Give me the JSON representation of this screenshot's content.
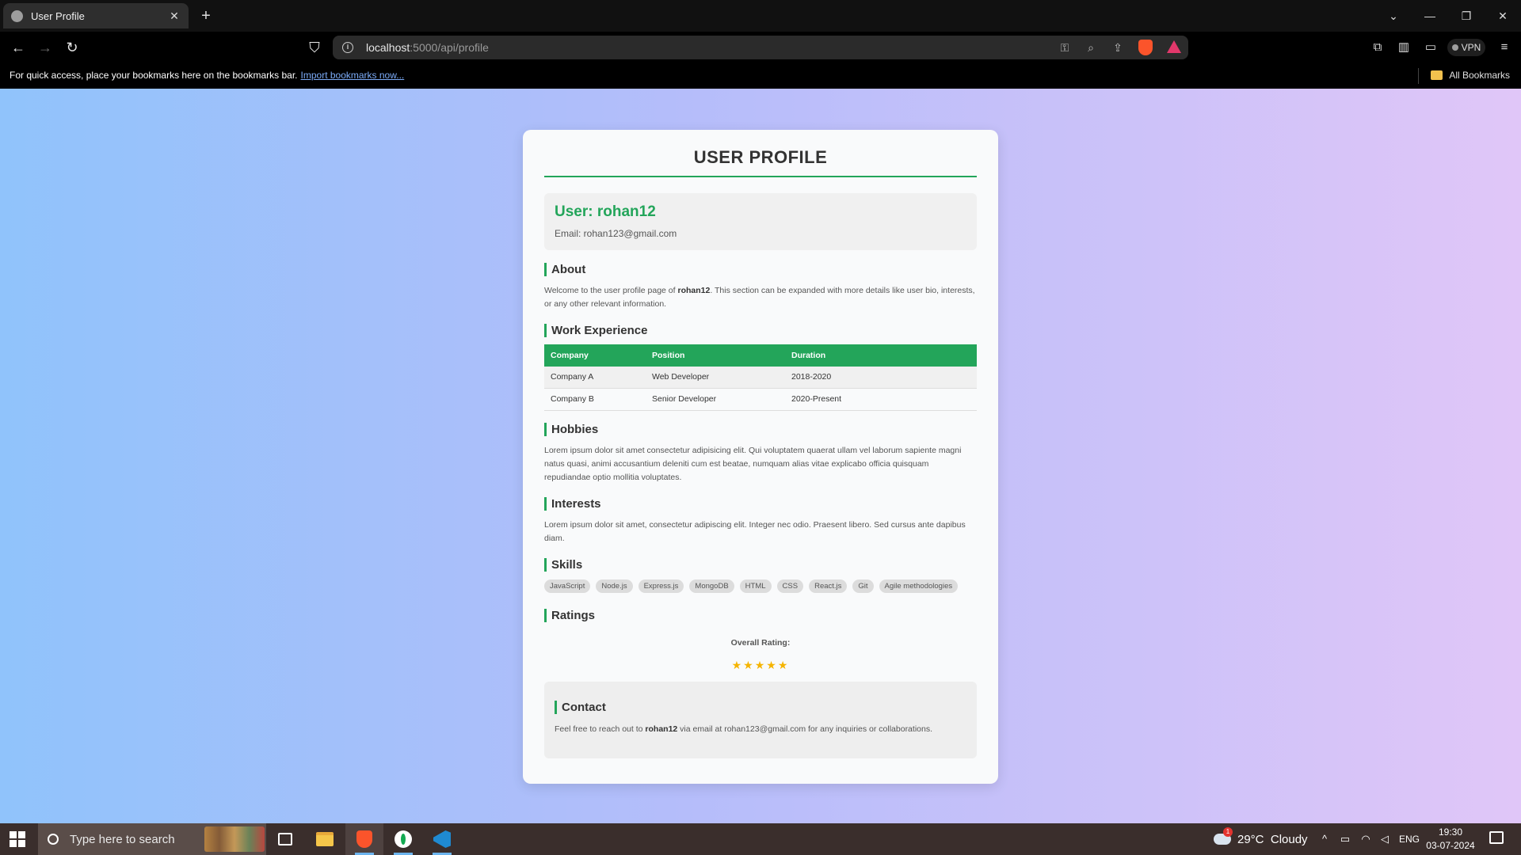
{
  "browser": {
    "tab_title": "User Profile",
    "tab_close": "✕",
    "new_tab": "+",
    "url_host": "localhost",
    "url_rest": ":5000/api/profile",
    "vpn_label": "VPN",
    "bookmarks_message": "For quick access, place your bookmarks here on the bookmarks bar.",
    "bookmarks_link": "Import bookmarks now...",
    "all_bookmarks": "All Bookmarks"
  },
  "profile": {
    "heading": "USER PROFILE",
    "user_line": "User: rohan12",
    "email_line": "Email: rohan123@gmail.com",
    "about": {
      "title": "About",
      "text_before": "Welcome to the user profile page of ",
      "username": "rohan12",
      "text_after": ". This section can be expanded with more details like user bio, interests, or any other relevant information."
    },
    "work": {
      "title": "Work Experience",
      "headers": [
        "Company",
        "Position",
        "Duration"
      ],
      "rows": [
        [
          "Company A",
          "Web Developer",
          "2018-2020"
        ],
        [
          "Company B",
          "Senior Developer",
          "2020-Present"
        ]
      ]
    },
    "hobbies": {
      "title": "Hobbies",
      "text": "Lorem ipsum dolor sit amet consectetur adipisicing elit. Qui voluptatem quaerat ullam vel laborum sapiente magni natus quasi, animi accusantium deleniti cum est beatae, numquam alias vitae explicabo officia quisquam repudiandae optio mollitia voluptates."
    },
    "interests": {
      "title": "Interests",
      "text": "Lorem ipsum dolor sit amet, consectetur adipiscing elit. Integer nec odio. Praesent libero. Sed cursus ante dapibus diam."
    },
    "skills": {
      "title": "Skills",
      "items": [
        "JavaScript",
        "Node.js",
        "Express.js",
        "MongoDB",
        "HTML",
        "CSS",
        "React.js",
        "Git",
        "Agile methodologies"
      ]
    },
    "ratings": {
      "title": "Ratings",
      "label": "Overall Rating:",
      "stars_filled": 5,
      "stars_total": 5,
      "stars_text": "★★★★★"
    },
    "contact": {
      "title": "Contact",
      "text_before": "Feel free to reach out to ",
      "username": "rohan12",
      "text_after": " via email at rohan123@gmail.com for any inquiries or collaborations."
    }
  },
  "taskbar": {
    "search_placeholder": "Type here to search",
    "weather_temp": "29°C",
    "weather_desc": "Cloudy",
    "weather_badge": "1",
    "language": "ENG",
    "time": "19:30",
    "date": "03-07-2024"
  },
  "colors": {
    "accent": "#23a55a",
    "star": "#f5b400"
  }
}
